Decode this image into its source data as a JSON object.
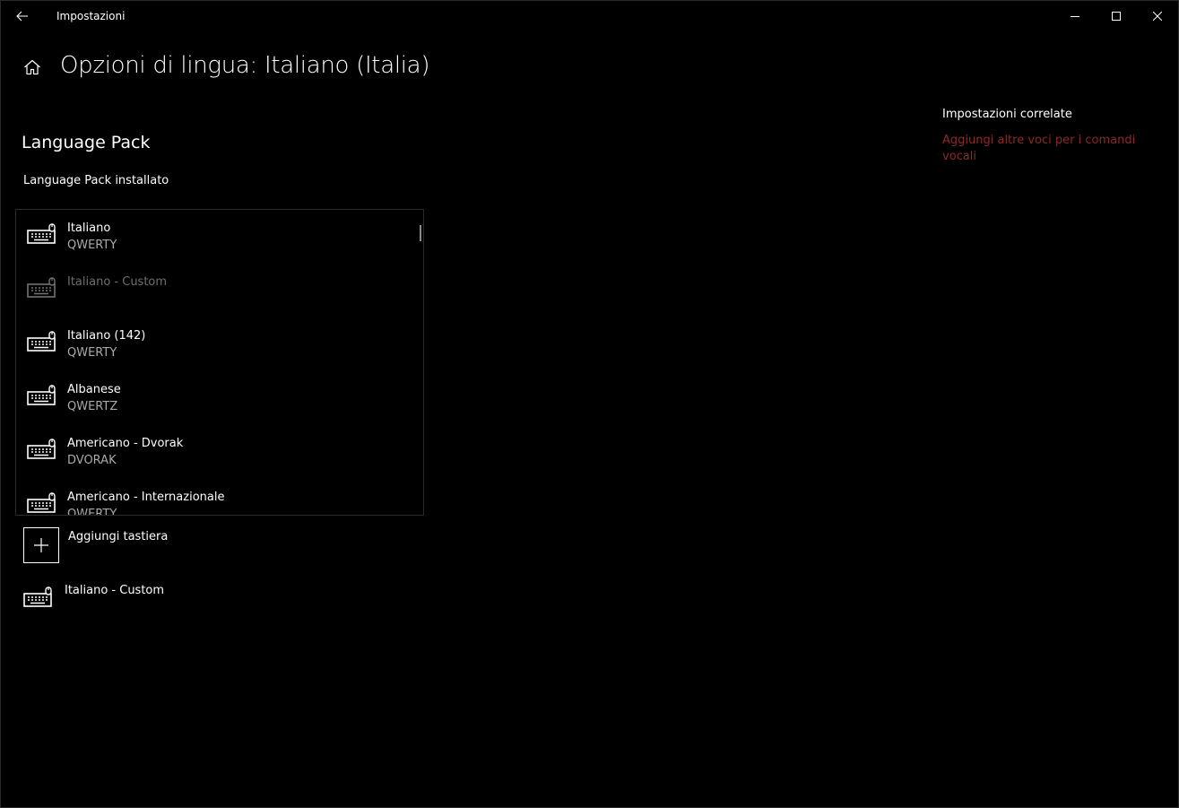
{
  "window": {
    "title": "Impostazioni"
  },
  "header": {
    "page_title": "Opzioni di lingua: Italiano (Italia)"
  },
  "language_pack": {
    "section_title": "Language Pack",
    "installed_label": "Language Pack installato"
  },
  "keyboards": [
    {
      "name": "Italiano",
      "layout": "QWERTY",
      "disabled": false,
      "icon": "keyboard-icon"
    },
    {
      "name": "Italiano - Custom",
      "layout": "",
      "disabled": true,
      "icon": "keyboard-icon"
    },
    {
      "name": "Italiano (142)",
      "layout": "QWERTY",
      "disabled": false,
      "icon": "keyboard-icon"
    },
    {
      "name": "Albanese",
      "layout": "QWERTZ",
      "disabled": false,
      "icon": "keyboard-icon"
    },
    {
      "name": "Americano - Dvorak",
      "layout": "DVORAK",
      "disabled": false,
      "icon": "keyboard-icon"
    },
    {
      "name": "Americano - Internazionale",
      "layout": "QWERTY",
      "disabled": false,
      "icon": "keyboard-icon"
    }
  ],
  "add_keyboard": {
    "label": "Aggiungi tastiera"
  },
  "custom_keyboard": {
    "name": "Italiano - Custom"
  },
  "related": {
    "title": "Impostazioni correlate",
    "link": "Aggiungi altre voci per i comandi vocali"
  },
  "colors": {
    "background": "#000000",
    "link": "#8b2a2a",
    "secondary_text": "#aaaaaa",
    "disabled_text": "#6e6e6e"
  }
}
